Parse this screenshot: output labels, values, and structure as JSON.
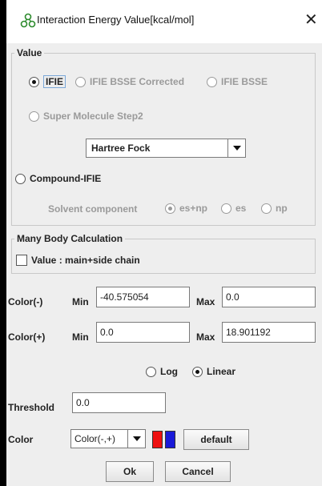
{
  "window": {
    "title": "Interaction Energy Value[kcal/mol]",
    "close_glyph": "✕",
    "icon": "molecule-icon"
  },
  "value_group": {
    "legend": "Value",
    "radios": {
      "ifie": "IFIE",
      "ifie_bsse_corrected": "IFIE BSSE Corrected",
      "ifie_bsse": "IFIE BSSE",
      "super_molecule": "Super Molecule Step2",
      "compound_ifie": "Compound-IFIE"
    },
    "method_dropdown": "Hartree Fock",
    "solvent": {
      "label": "Solvent component",
      "es_np": "es+np",
      "es": "es",
      "np": "np"
    }
  },
  "many_body": {
    "legend": "Many Body Calculation",
    "checkbox_label": "Value : main+side chain"
  },
  "color_minus": {
    "label": "Color(-)",
    "min_label": "Min",
    "min_value": "-40.575054",
    "max_label": "Max",
    "max_value": "0.0"
  },
  "color_plus": {
    "label": "Color(+)",
    "min_label": "Min",
    "min_value": "0.0",
    "max_label": "Max",
    "max_value": "18.901192"
  },
  "scale": {
    "log": "Log",
    "linear": "Linear"
  },
  "threshold": {
    "label": "Threshold",
    "value": "0.0"
  },
  "color_row": {
    "label": "Color",
    "dropdown": "Color(-,+)",
    "swatch_neg": "#ee1111",
    "swatch_pos": "#1a1ad8",
    "default_button": "default"
  },
  "buttons": {
    "ok": "Ok",
    "cancel": "Cancel"
  }
}
